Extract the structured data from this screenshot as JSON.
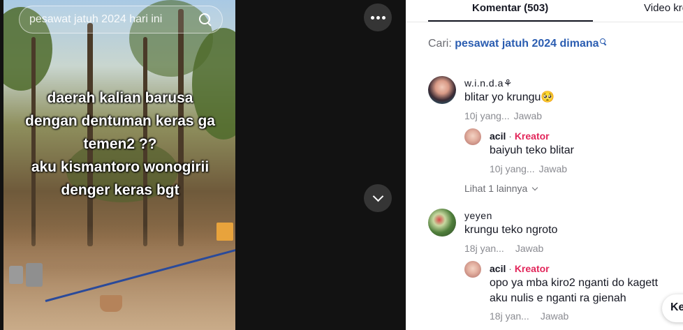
{
  "video": {
    "search_text": "pesawat jatuh 2024 hari ini",
    "overlay_lines": [
      "daerah kalian barusa",
      "dengan dentuman keras ga",
      "temen2 ??",
      "aku kismantoro wonogirii",
      "denger keras bgt"
    ]
  },
  "tabs": [
    {
      "label": "Komentar (503)",
      "active": true
    },
    {
      "label": "Video kre"
    }
  ],
  "search": {
    "prefix": "Cari:",
    "query": "pesawat jatuh 2024 dimana"
  },
  "comments": [
    {
      "username": "w.i.n.d.a⚘",
      "text": "blitar yo krungu🥺",
      "time": "10j yang...",
      "reply_label": "Jawab",
      "replies": [
        {
          "username": "acil",
          "tag": "Kreator",
          "text": "baiyuh teko blitar",
          "time": "10j yang...",
          "reply_label": "Jawab"
        }
      ],
      "view_more": "Lihat 1 lainnya"
    },
    {
      "username": "yeyen",
      "text": "krungu teko ngroto",
      "time": "18j yan...",
      "reply_label": "Jawab",
      "replies": [
        {
          "username": "acil",
          "tag": "Kreator",
          "text_lines": [
            "opo ya mba kiro2 nganti do kagett",
            "aku nulis e nganti ra gienah"
          ],
          "time": "18j yan...",
          "reply_label": "Jawab"
        }
      ]
    }
  ],
  "floating_button": "Ke",
  "colors": {
    "creator_tag": "#e2265a",
    "search_link": "#2b5db1",
    "video_bg": "#121212"
  }
}
